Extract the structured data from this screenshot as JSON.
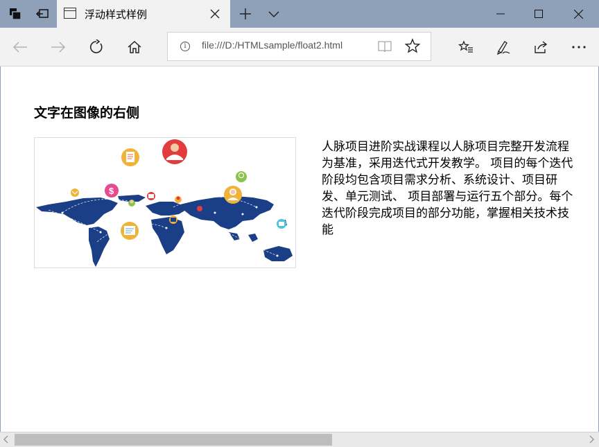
{
  "browser": {
    "tab": {
      "title": "浮动样式样例"
    },
    "address": {
      "url": "file:///D:/HTMLsample/float2.html"
    }
  },
  "page": {
    "heading": "文字在图像的右侧",
    "paragraph": "人脉项目进阶实战课程以人脉项目完整开发流程为基准，采用迭代式开发教学。 项目的每个迭代阶段均包含项目需求分析、系统设计、项目研发、单元测试、 项目部署与运行五个部分。每个迭代阶段完成项目的部分功能，掌握相关技术技能",
    "image": {
      "icon": "world-map-social-network-image"
    }
  },
  "colors": {
    "titlebar": "#8fa1b9",
    "toolbar": "#f2f2f2",
    "map": "#1a3f87",
    "scroll_thumb": "#bdbdbd"
  },
  "scrollbar": {
    "horizontal_position": 0.0
  }
}
